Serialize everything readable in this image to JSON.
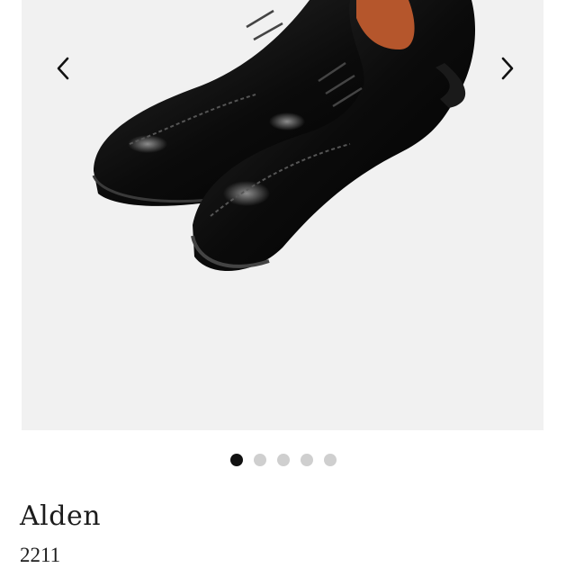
{
  "product": {
    "brand": "Alden",
    "model": "2211"
  },
  "gallery": {
    "prev_icon": "chevron-left-icon",
    "next_icon": "chevron-right-icon",
    "image_count": 5,
    "active_index": 0,
    "dot_active_color": "#111111",
    "dot_inactive_color": "#cfcfcf"
  }
}
